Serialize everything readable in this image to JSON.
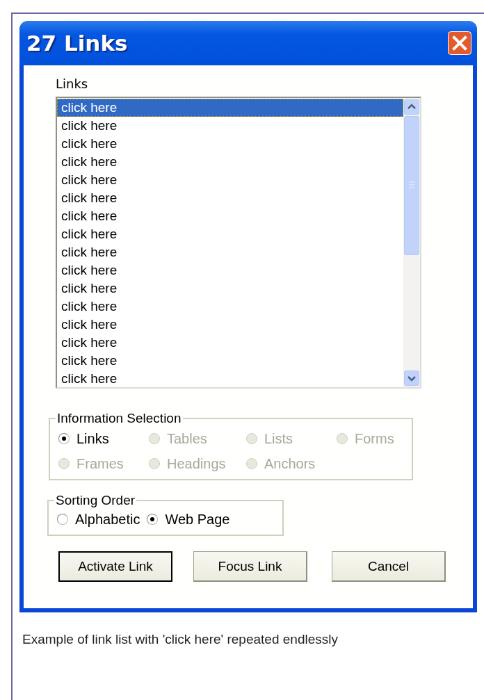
{
  "window": {
    "title": "27 Links"
  },
  "links": {
    "label": "Links",
    "items": [
      {
        "text": "click here",
        "selected": true
      },
      {
        "text": "click here",
        "selected": false
      },
      {
        "text": "click here",
        "selected": false
      },
      {
        "text": "click here",
        "selected": false
      },
      {
        "text": "click here",
        "selected": false
      },
      {
        "text": "click here",
        "selected": false
      },
      {
        "text": "click here",
        "selected": false
      },
      {
        "text": "click here",
        "selected": false
      },
      {
        "text": "click here",
        "selected": false
      },
      {
        "text": "click here",
        "selected": false
      },
      {
        "text": "click here",
        "selected": false
      },
      {
        "text": "click here",
        "selected": false
      },
      {
        "text": "click here",
        "selected": false
      },
      {
        "text": "click here",
        "selected": false
      },
      {
        "text": "click here",
        "selected": false
      },
      {
        "text": "click here",
        "selected": false
      }
    ]
  },
  "information_selection": {
    "title": "Information Selection",
    "options": [
      {
        "label": "Links",
        "selected": true,
        "disabled": false
      },
      {
        "label": "Tables",
        "selected": false,
        "disabled": true
      },
      {
        "label": "Lists",
        "selected": false,
        "disabled": true
      },
      {
        "label": "Forms",
        "selected": false,
        "disabled": true
      },
      {
        "label": "Frames",
        "selected": false,
        "disabled": true
      },
      {
        "label": "Headings",
        "selected": false,
        "disabled": true
      },
      {
        "label": "Anchors",
        "selected": false,
        "disabled": true
      }
    ]
  },
  "sorting_order": {
    "title": "Sorting Order",
    "options": [
      {
        "label": "Alphabetic",
        "selected": false,
        "disabled": false
      },
      {
        "label": "Web Page",
        "selected": true,
        "disabled": false
      }
    ]
  },
  "buttons": [
    {
      "label": "Activate Link",
      "default": true
    },
    {
      "label": "Focus Link",
      "default": false
    },
    {
      "label": "Cancel",
      "default": false
    }
  ],
  "caption": "Example of link list with 'click here' repeated endlessly"
}
